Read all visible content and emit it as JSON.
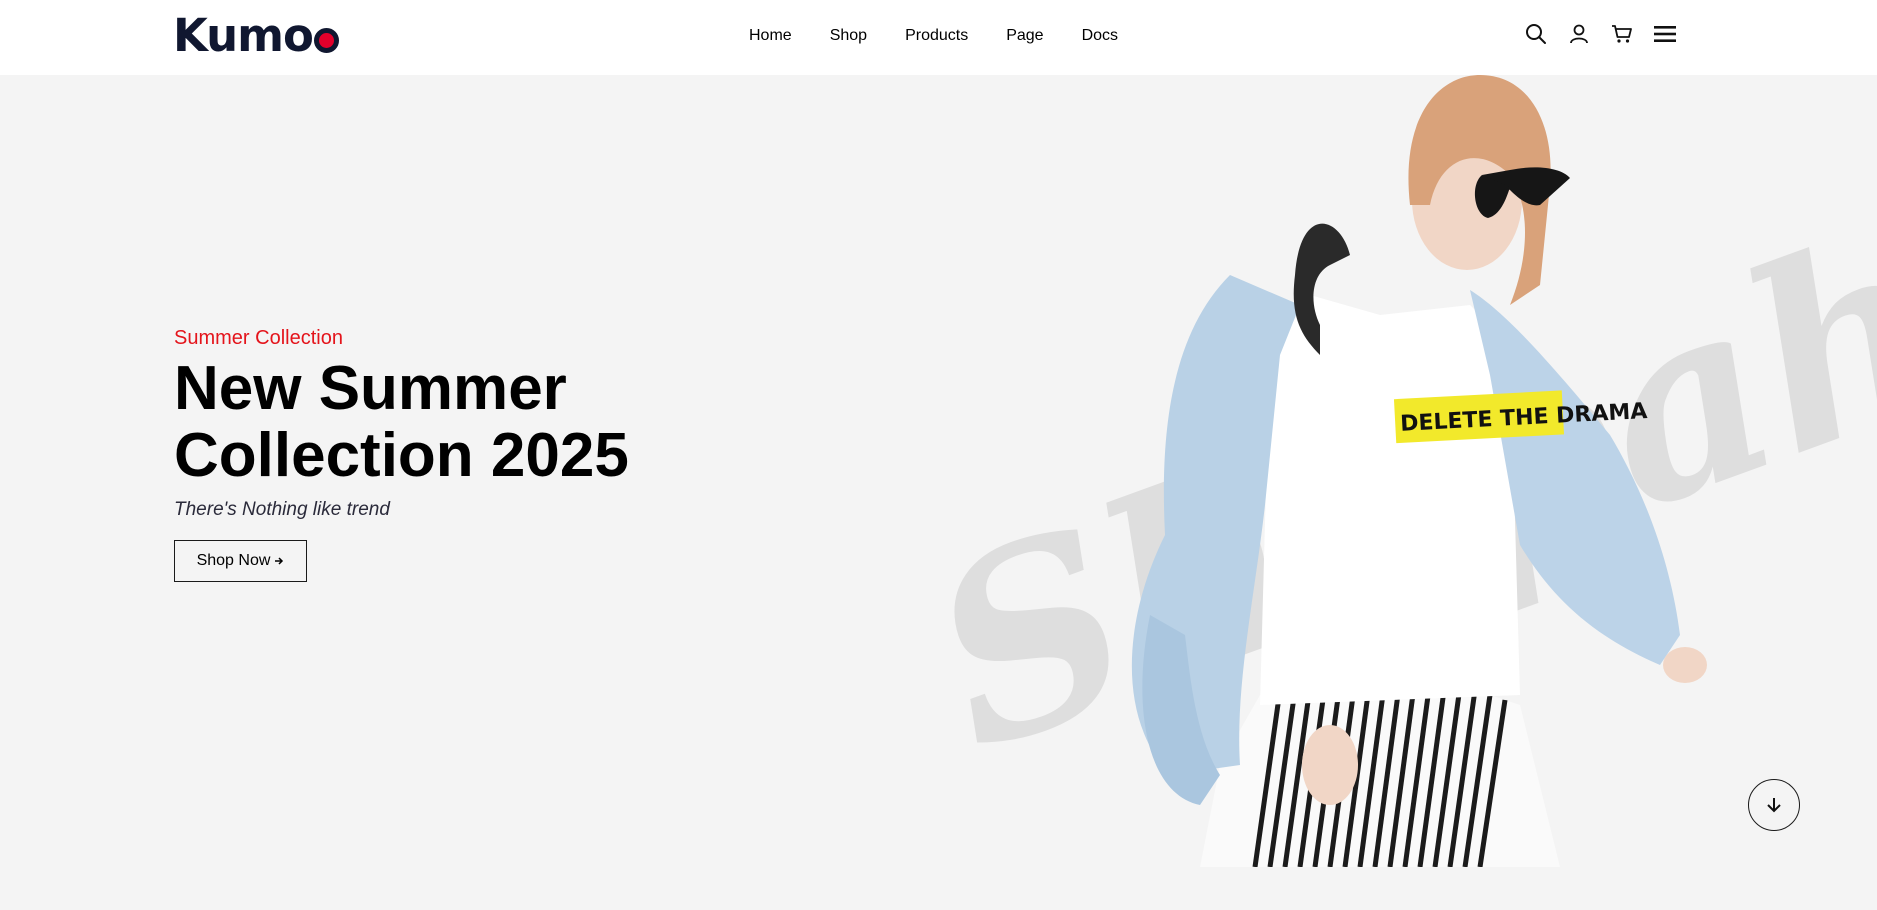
{
  "brand": {
    "name": "Kumo",
    "accent": "#e4002b",
    "ink": "#101730"
  },
  "nav": {
    "items": [
      "Home",
      "Shop",
      "Products",
      "Page",
      "Docs"
    ]
  },
  "header_icons": [
    "search-icon",
    "user-icon",
    "cart-icon",
    "menu-icon"
  ],
  "hero": {
    "eyebrow": "Summer Collection",
    "headline_line1": "New Summer",
    "headline_line2": "Collection 2025",
    "tagline": "There's Nothing like trend",
    "cta_label": "Shop Now",
    "cta_icon": "arrow-right-icon",
    "watermark_text": "Shopaholic",
    "tshirt_print": "DELETE THE DRAMA",
    "scroll_icon": "arrow-down-icon"
  },
  "colors": {
    "eyebrow": "#e4141b",
    "page_bg": "#f4f4f4",
    "header_bg": "#ffffff"
  }
}
